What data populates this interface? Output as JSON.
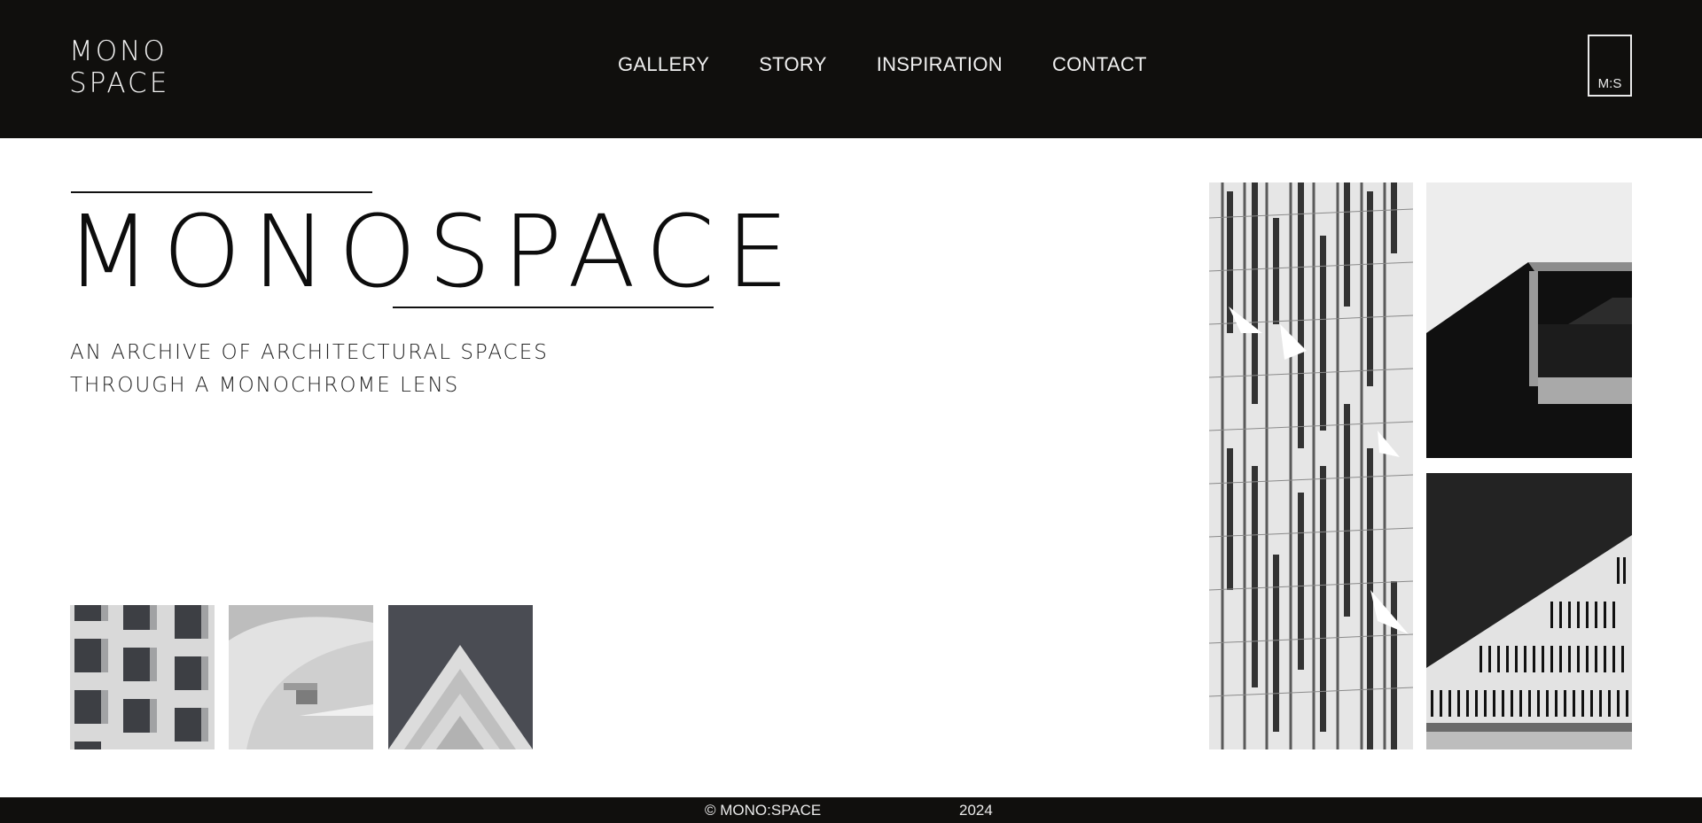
{
  "header": {
    "logo_line1": "MONO",
    "logo_line2": "SPACE",
    "nav": [
      "GALLERY",
      "STORY",
      "INSPIRATION",
      "CONTACT"
    ],
    "badge": "M:S"
  },
  "hero": {
    "title": "MONOSPACE",
    "subtitle_line1": "AN ARCHIVE OF ARCHITECTURAL SPACES",
    "subtitle_line2": "THROUGH A MONOCHROME LENS"
  },
  "thumbnails": [
    "facade-windows",
    "curved-building",
    "stacked-balconies"
  ],
  "gallery": [
    "glass-tower-facade",
    "cantilever-building",
    "slatted-roofline"
  ],
  "footer": {
    "copyright": "© MONO:SPACE",
    "year": "2024"
  },
  "colors": {
    "header_bg": "#100f0d",
    "page_bg": "#ffffff",
    "text_light": "#f0f0f0"
  }
}
